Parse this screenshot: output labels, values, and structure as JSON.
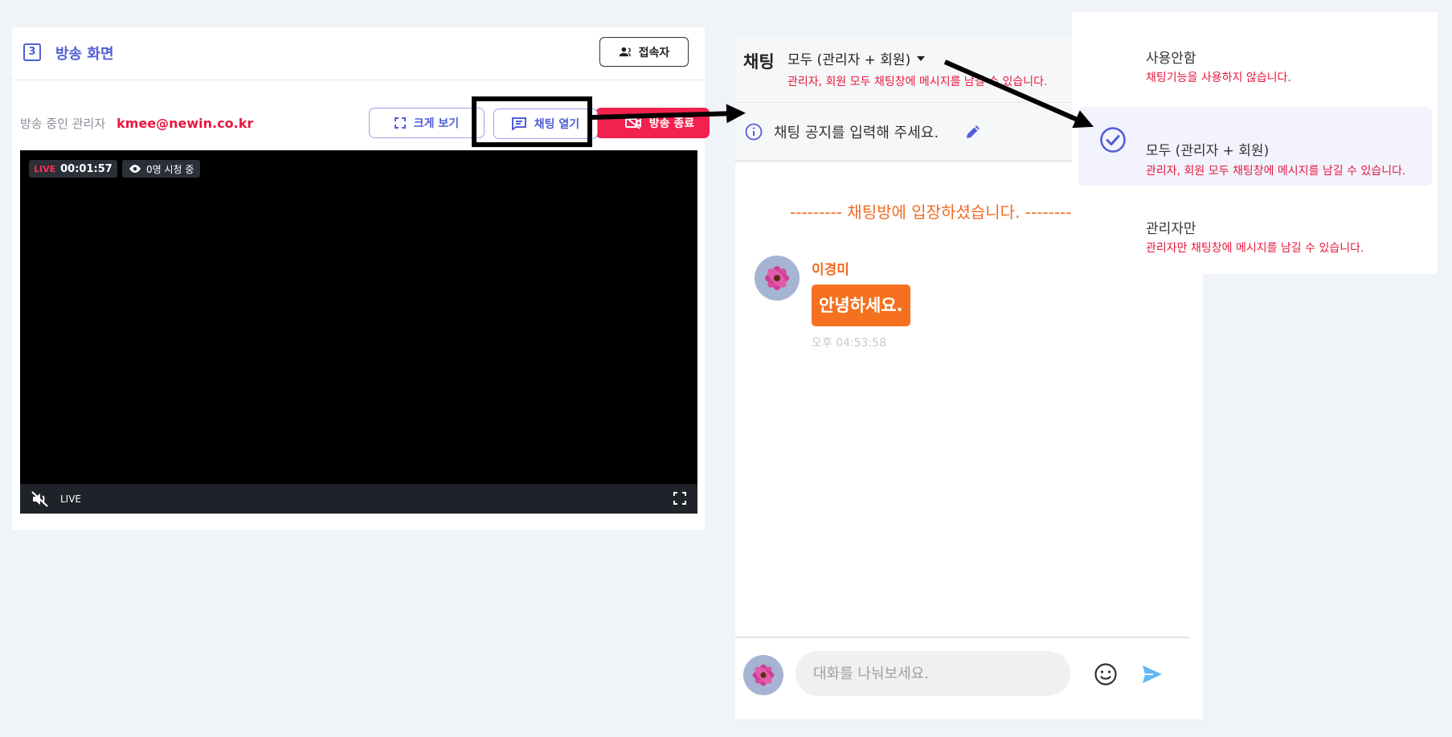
{
  "left_panel": {
    "step_number": "3",
    "title": "방송 화면",
    "viewer_button": "접속자",
    "admin_label": "방송 중인 관리자",
    "admin_email": "kmee@newin.co.kr",
    "btn_full_view": "크게 보기",
    "btn_chat_open": "채팅 열기",
    "btn_end_live": "방송 종료",
    "video": {
      "live_badge": "LIVE",
      "elapsed": "00:01:57",
      "viewers": "0명 시청 중",
      "bar_live": "LIVE"
    }
  },
  "chat": {
    "title": "채팅",
    "mode": "모두 (관리자 + 회원)",
    "mode_desc": "관리자, 회원 모두 채팅창에 메시지를 남길 수 있습니다.",
    "notice_placeholder": "채팅 공지를 입력해 주세요.",
    "enter_message": "--------- 채팅방에 입장하셨습니다. ---------",
    "messages": [
      {
        "name": "이경미",
        "text": "안녕하세요.",
        "time": "오후 04:53:58"
      }
    ],
    "input_placeholder": "대화를 나눠보세요."
  },
  "dropdown": {
    "options": [
      {
        "label": "사용안함",
        "desc": "채팅기능을 사용하지 않습니다.",
        "selected": false
      },
      {
        "label": "모두 (관리자 + 회원)",
        "desc": "관리자, 회원 모두 채팅창에 메시지를 남길 수 있습니다.",
        "selected": true
      },
      {
        "label": "관리자만",
        "desc": "관리자만 채팅창에 메시지를 남길 수 있습니다.",
        "selected": false
      }
    ]
  },
  "colors": {
    "accent": "#4f5fd6",
    "danger": "#e8173d",
    "chat_orange": "#f57120"
  }
}
